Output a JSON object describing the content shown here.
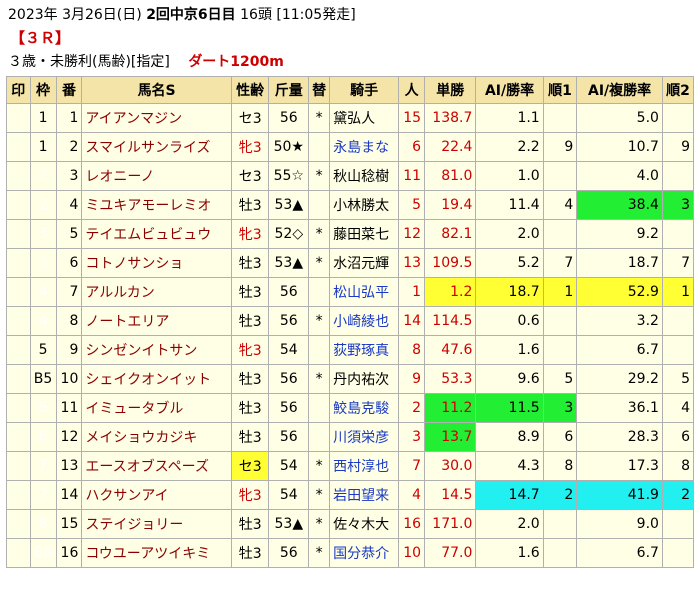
{
  "header": {
    "date": "2023年 3月26日(日)",
    "venue": "2回中京6日目",
    "runners": "16頭",
    "post_time": "[11:05発走]"
  },
  "race_no": "【３Ｒ】",
  "conditions": "３歳・未勝利(馬齢)[指定]",
  "course": "ダート1200m",
  "columns": [
    "印",
    "枠",
    "番",
    "馬名S",
    "性齢",
    "斤量",
    "替",
    "騎手",
    "人",
    "単勝",
    "AI/勝率",
    "順1",
    "AI/複勝率",
    "順2"
  ],
  "colors": {
    "header_bg": "#f4e4a8",
    "cell_bg": "#ffffe6",
    "name_text": "#8a0000",
    "jockey_blue": "#1a39c4",
    "highlight_yellow": "#ffff33",
    "highlight_green": "#22ee33",
    "highlight_cyan": "#22f0f0"
  },
  "rows": [
    {
      "mark": "",
      "waku": "1",
      "waku_class": "w1",
      "num": "1",
      "name": "アイアンマジン",
      "sex": "セ3",
      "sex_hl": "",
      "weight": "56",
      "kae": "*",
      "jockey": "黛弘人",
      "jockey_blue": false,
      "pop": "15",
      "odds": "138.7",
      "odds_hl": "",
      "ai_win": "1.1",
      "ai_win_hl": "",
      "rank1": "",
      "ai_place": "5.0",
      "ai_place_hl": "",
      "rank2": ""
    },
    {
      "mark": "",
      "waku": "1",
      "waku_class": "w1",
      "num": "2",
      "name": "スマイルサンライズ",
      "sex": "牝3",
      "sex_hl": "",
      "weight": "50★",
      "kae": "",
      "jockey": "永島まな",
      "jockey_blue": true,
      "pop": "6",
      "odds": "22.4",
      "odds_hl": "",
      "ai_win": "2.2",
      "ai_win_hl": "",
      "rank1": "9",
      "ai_place": "10.7",
      "ai_place_hl": "",
      "rank2": "9"
    },
    {
      "mark": "",
      "waku": "2",
      "waku_class": "w2",
      "num": "3",
      "name": "レオニーノ",
      "sex": "セ3",
      "sex_hl": "",
      "weight": "55☆",
      "kae": "*",
      "jockey": "秋山稔樹",
      "jockey_blue": false,
      "pop": "11",
      "odds": "81.0",
      "odds_hl": "",
      "ai_win": "1.0",
      "ai_win_hl": "",
      "rank1": "",
      "ai_place": "4.0",
      "ai_place_hl": "",
      "rank2": ""
    },
    {
      "mark": "",
      "waku": "2",
      "waku_class": "w2",
      "num": "4",
      "name": "ミユキアモーレミオ",
      "sex": "牡3",
      "sex_hl": "",
      "weight": "53▲",
      "kae": "",
      "jockey": "小林勝太",
      "jockey_blue": false,
      "pop": "5",
      "odds": "19.4",
      "odds_hl": "",
      "ai_win": "11.4",
      "ai_win_hl": "",
      "rank1": "4",
      "ai_place": "38.4",
      "ai_place_hl": "green",
      "rank2": "3"
    },
    {
      "mark": "",
      "waku": "3",
      "waku_class": "w3",
      "num": "5",
      "name": "テイエムビュビュウ",
      "sex": "牝3",
      "sex_hl": "",
      "weight": "52◇",
      "kae": "*",
      "jockey": "藤田菜七",
      "jockey_blue": false,
      "pop": "12",
      "odds": "82.1",
      "odds_hl": "",
      "ai_win": "2.0",
      "ai_win_hl": "",
      "rank1": "",
      "ai_place": "9.2",
      "ai_place_hl": "",
      "rank2": ""
    },
    {
      "mark": "",
      "waku": "3",
      "waku_class": "w3",
      "num": "6",
      "name": "コトノサンショ",
      "sex": "牡3",
      "sex_hl": "",
      "weight": "53▲",
      "kae": "*",
      "jockey": "水沼元輝",
      "jockey_blue": false,
      "pop": "13",
      "odds": "109.5",
      "odds_hl": "",
      "ai_win": "5.2",
      "ai_win_hl": "",
      "rank1": "7",
      "ai_place": "18.7",
      "ai_place_hl": "",
      "rank2": "7"
    },
    {
      "mark": "",
      "waku": "4",
      "waku_class": "w4",
      "num": "7",
      "name": "アルルカン",
      "sex": "牡3",
      "sex_hl": "",
      "weight": "56",
      "kae": "",
      "jockey": "松山弘平",
      "jockey_blue": true,
      "pop": "1",
      "odds": "1.2",
      "odds_hl": "yellow",
      "ai_win": "18.7",
      "ai_win_hl": "yellow",
      "rank1": "1",
      "ai_place": "52.9",
      "ai_place_hl": "yellow",
      "rank2": "1"
    },
    {
      "mark": "",
      "waku": "4",
      "waku_class": "w4",
      "num": "8",
      "name": "ノートエリア",
      "sex": "牡3",
      "sex_hl": "",
      "weight": "56",
      "kae": "*",
      "jockey": "小崎綾也",
      "jockey_blue": true,
      "pop": "14",
      "odds": "114.5",
      "odds_hl": "",
      "ai_win": "0.6",
      "ai_win_hl": "",
      "rank1": "",
      "ai_place": "3.2",
      "ai_place_hl": "",
      "rank2": ""
    },
    {
      "mark": "",
      "waku": "5",
      "waku_class": "w5",
      "num": "9",
      "name": "シンゼンイトサン",
      "sex": "牝3",
      "sex_hl": "",
      "weight": "54",
      "kae": "",
      "jockey": "荻野琢真",
      "jockey_blue": true,
      "pop": "8",
      "odds": "47.6",
      "odds_hl": "",
      "ai_win": "1.6",
      "ai_win_hl": "",
      "rank1": "",
      "ai_place": "6.7",
      "ai_place_hl": "",
      "rank2": ""
    },
    {
      "mark": "",
      "waku": "B5",
      "waku_class": "w5",
      "num": "10",
      "name": "シェイクオンイット",
      "sex": "牡3",
      "sex_hl": "",
      "weight": "56",
      "kae": "*",
      "jockey": "丹内祐次",
      "jockey_blue": false,
      "pop": "9",
      "odds": "53.3",
      "odds_hl": "",
      "ai_win": "9.6",
      "ai_win_hl": "",
      "rank1": "5",
      "ai_place": "29.2",
      "ai_place_hl": "",
      "rank2": "5"
    },
    {
      "mark": "",
      "waku": "6",
      "waku_class": "w6",
      "num": "11",
      "name": "イミュータブル",
      "sex": "牡3",
      "sex_hl": "",
      "weight": "56",
      "kae": "",
      "jockey": "鮫島克駿",
      "jockey_blue": true,
      "pop": "2",
      "odds": "11.2",
      "odds_hl": "green",
      "ai_win": "11.5",
      "ai_win_hl": "green",
      "rank1": "3",
      "ai_place": "36.1",
      "ai_place_hl": "",
      "rank2": "4"
    },
    {
      "mark": "",
      "waku": "6",
      "waku_class": "w6",
      "num": "12",
      "name": "メイショウカジキ",
      "sex": "牡3",
      "sex_hl": "",
      "weight": "56",
      "kae": "",
      "jockey": "川須栄彦",
      "jockey_blue": true,
      "pop": "3",
      "odds": "13.7",
      "odds_hl": "green",
      "ai_win": "8.9",
      "ai_win_hl": "",
      "rank1": "6",
      "ai_place": "28.3",
      "ai_place_hl": "",
      "rank2": "6"
    },
    {
      "mark": "",
      "waku": "7",
      "waku_class": "w7",
      "num": "13",
      "name": "エースオブスペーズ",
      "sex": "セ3",
      "sex_hl": "yellow",
      "weight": "54",
      "kae": "*",
      "jockey": "西村淳也",
      "jockey_blue": true,
      "pop": "7",
      "odds": "30.0",
      "odds_hl": "",
      "ai_win": "4.3",
      "ai_win_hl": "",
      "rank1": "8",
      "ai_place": "17.3",
      "ai_place_hl": "",
      "rank2": "8"
    },
    {
      "mark": "",
      "waku": "7",
      "waku_class": "w7",
      "num": "14",
      "name": "ハクサンアイ",
      "sex": "牝3",
      "sex_hl": "",
      "weight": "54",
      "kae": "*",
      "jockey": "岩田望来",
      "jockey_blue": true,
      "pop": "4",
      "odds": "14.5",
      "odds_hl": "",
      "ai_win": "14.7",
      "ai_win_hl": "cyan",
      "rank1": "2",
      "ai_place": "41.9",
      "ai_place_hl": "cyan",
      "rank2": "2"
    },
    {
      "mark": "",
      "waku": "8",
      "waku_class": "w8",
      "num": "15",
      "name": "ステイジョリー",
      "sex": "牡3",
      "sex_hl": "",
      "weight": "53▲",
      "kae": "*",
      "jockey": "佐々木大",
      "jockey_blue": false,
      "pop": "16",
      "odds": "171.0",
      "odds_hl": "",
      "ai_win": "2.0",
      "ai_win_hl": "",
      "rank1": "",
      "ai_place": "9.0",
      "ai_place_hl": "",
      "rank2": ""
    },
    {
      "mark": "",
      "waku": "B8",
      "waku_class": "w8",
      "num": "16",
      "name": "コウユーアツイキミ",
      "sex": "牡3",
      "sex_hl": "",
      "weight": "56",
      "kae": "*",
      "jockey": "国分恭介",
      "jockey_blue": true,
      "pop": "10",
      "odds": "77.0",
      "odds_hl": "",
      "ai_win": "1.6",
      "ai_win_hl": "",
      "rank1": "",
      "ai_place": "6.7",
      "ai_place_hl": "",
      "rank2": ""
    }
  ]
}
